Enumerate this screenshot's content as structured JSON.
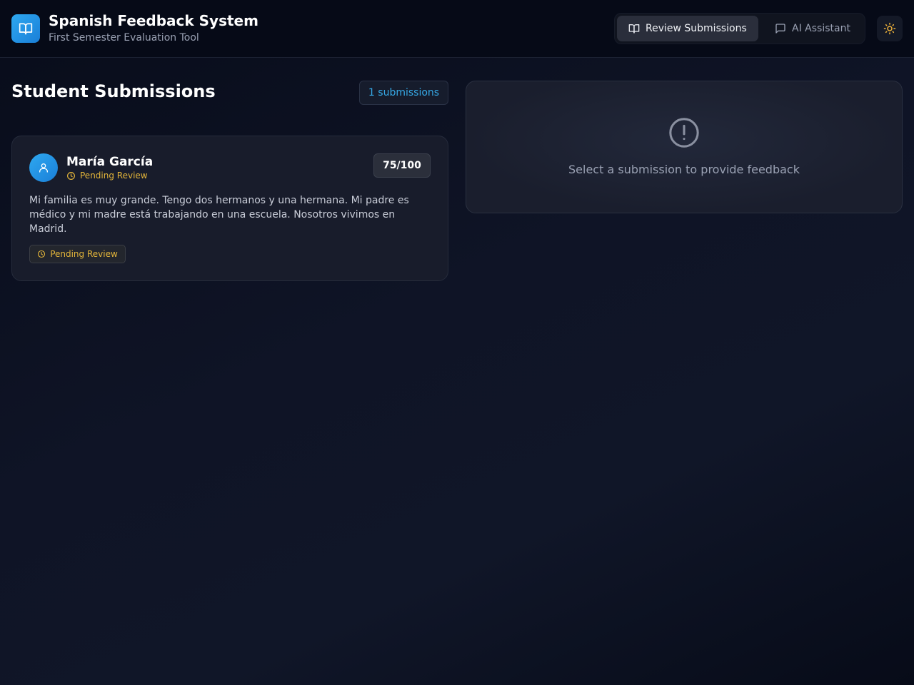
{
  "header": {
    "title": "Spanish Feedback System",
    "subtitle": "First Semester Evaluation Tool",
    "logo_icon": "book-open-icon",
    "nav": [
      {
        "label": "Review Submissions",
        "icon": "book-open-icon",
        "active": true
      },
      {
        "label": "AI Assistant",
        "icon": "message-square-icon",
        "active": false
      }
    ],
    "theme_toggle_icon": "sun-icon"
  },
  "submissions": {
    "title": "Student Submissions",
    "count_label": "1 submissions",
    "items": [
      {
        "student_name": "María García",
        "status": "Pending Review",
        "score": "75/100",
        "text": "Mi familia es muy grande. Tengo dos hermanos y una hermana. Mi padre es médico y mi madre está trabajando en una escuela. Nosotros vivimos en Madrid.",
        "status_chip": "Pending Review"
      }
    ]
  },
  "feedback_panel": {
    "empty_message": "Select a submission to provide feedback",
    "icon": "alert-circle-icon"
  },
  "colors": {
    "accent": "#2ea8f0",
    "pending": "#e3b53a",
    "background": "#0f1426"
  }
}
